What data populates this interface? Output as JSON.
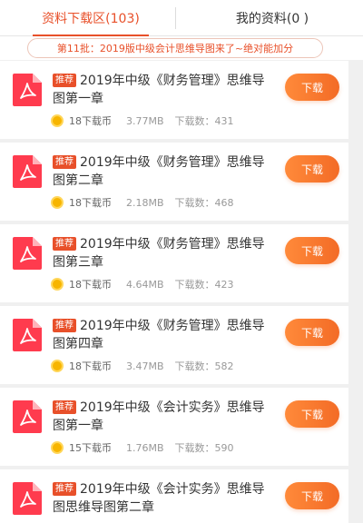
{
  "tabs": [
    {
      "label": "资料下载区(103)",
      "active": true
    },
    {
      "label": "我的资料(0 )",
      "active": false
    }
  ],
  "notice": "第11批：2019版中级会计思维导图来了~绝对能加分",
  "colors": {
    "accent": "#e8502a",
    "button": "#f47a2e",
    "coin": "#f7b500"
  },
  "items": [
    {
      "badge": "推荐",
      "title": "2019年中级《财务管理》思维导图第一章",
      "cost": "18下载币",
      "size": "3.77MB",
      "downloads": "下载数：431",
      "button": "下载"
    },
    {
      "badge": "推荐",
      "title": "2019年中级《财务管理》思维导图第二章",
      "cost": "18下载币",
      "size": "2.18MB",
      "downloads": "下载数：468",
      "button": "下载"
    },
    {
      "badge": "推荐",
      "title": "2019年中级《财务管理》思维导图第三章",
      "cost": "18下载币",
      "size": "4.64MB",
      "downloads": "下载数：423",
      "button": "下载"
    },
    {
      "badge": "推荐",
      "title": "2019年中级《财务管理》思维导图第四章",
      "cost": "18下载币",
      "size": "3.47MB",
      "downloads": "下载数：582",
      "button": "下载"
    },
    {
      "badge": "推荐",
      "title": "2019年中级《会计实务》思维导图第一章",
      "cost": "15下载币",
      "size": "1.76MB",
      "downloads": "下载数：590",
      "button": "下载"
    },
    {
      "badge": "推荐",
      "title": "2019年中级《会计实务》思维导图思维导图第二章",
      "cost": "",
      "size": "",
      "downloads": "",
      "button": "下载"
    }
  ]
}
